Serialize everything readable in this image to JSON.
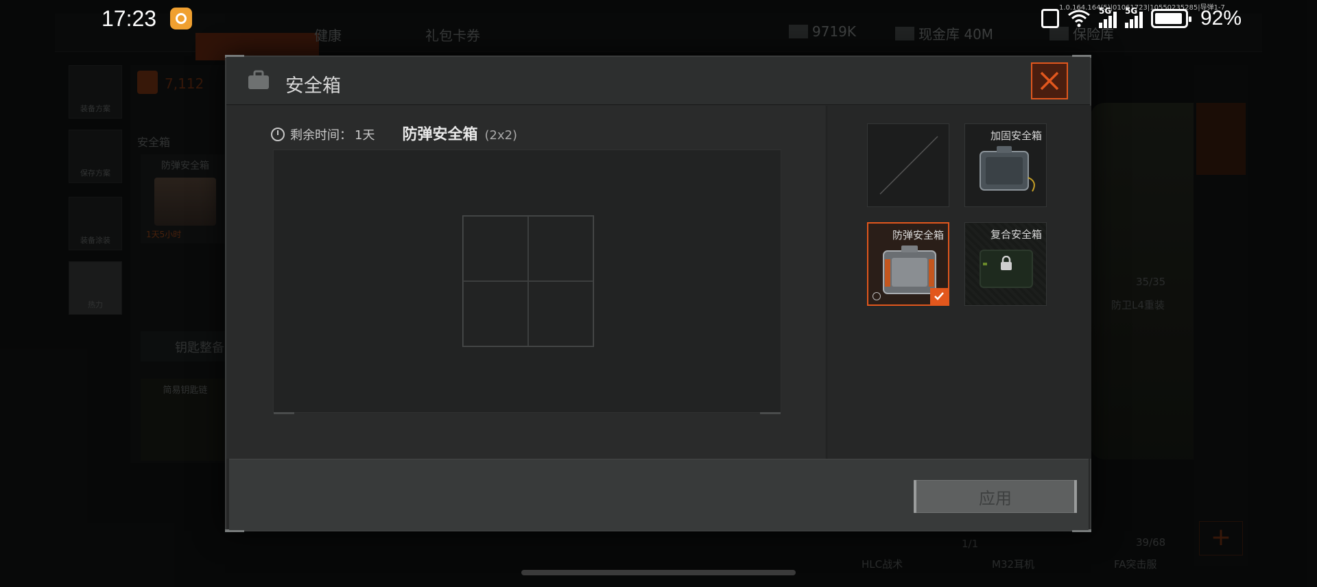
{
  "status_bar": {
    "time": "17:23",
    "build_info": "1.0.164.164(5)|01061723|10550235285|导弹1-7",
    "signal_label_1": "5G",
    "signal_label_2": "5G",
    "wifi_label": "7",
    "battery": "92%",
    "battery_level": 0.92
  },
  "background": {
    "tabs": [
      "健康",
      "礼包卡券"
    ],
    "currency_1": "9719K",
    "currency_2": "现金库 40M",
    "currency_3": "保险库",
    "rail_buttons": [
      "装备方案",
      "保存方案",
      "装备涂装",
      "热力"
    ],
    "item_count": "7,112",
    "safe_label": "安全箱",
    "safe_card_title": "防弹安全箱",
    "safe_card_time": "1天5小时",
    "keys_label": "钥匙整备",
    "keychain_label": "简易钥匙链",
    "armor_stat": "35/35",
    "armor_name": "防卫L4重装",
    "ammo_stat": "1/1",
    "capacity_stat": "39/68",
    "bottom_labels": [
      "HLC战术",
      "M32耳机",
      "FA突击服"
    ]
  },
  "modal": {
    "title": "安全箱",
    "remaining_label": "剩余时间：",
    "remaining_value": "1天",
    "case_name": "防弹安全箱",
    "case_size": "(2x2)",
    "slots": [
      {
        "label": "",
        "state": "empty"
      },
      {
        "label": "加固安全箱",
        "state": "available"
      },
      {
        "label": "防弹安全箱",
        "state": "selected"
      },
      {
        "label": "复合安全箱",
        "state": "locked"
      }
    ],
    "apply_label": "应用"
  },
  "colors": {
    "accent": "#e2571d",
    "panel": "#262727",
    "footer": "#383a3a"
  }
}
